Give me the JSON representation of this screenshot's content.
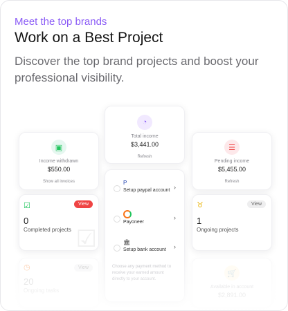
{
  "header": {
    "eyebrow": "Meet the top brands",
    "title": "Work on a Best Project",
    "description": "Discover the top brand projects and boost your professional visibility."
  },
  "tiles": {
    "total_income": {
      "label": "Total income",
      "amount": "$3,441.00",
      "link": "Refresh"
    },
    "income_withdrawn": {
      "label": "Income withdrawn",
      "amount": "$550.00",
      "link": "Show all invoices"
    },
    "pending_income": {
      "label": "Pending income",
      "amount": "$5,455.00",
      "link": "Refresh"
    },
    "completed_projects": {
      "count": "0",
      "label": "Completed projects",
      "badge": "View"
    },
    "ongoing_projects": {
      "count": "1",
      "label": "Ongoing projects",
      "badge": "View"
    },
    "ongoing_tasks": {
      "count": "20",
      "label": "Ongoing tasks",
      "badge": "View"
    },
    "available_in_account": {
      "label": "Available in account",
      "amount": "$2,891.00"
    },
    "payment_setup": {
      "options": [
        "Setup paypal account",
        "Payoneer",
        "Setup bank account"
      ],
      "helper": "Choose any payment method to receive your earned amount directly to your account."
    }
  },
  "colors": {
    "accent": "#8b5cf6",
    "danger": "#ef4444",
    "success": "#22c55e"
  }
}
